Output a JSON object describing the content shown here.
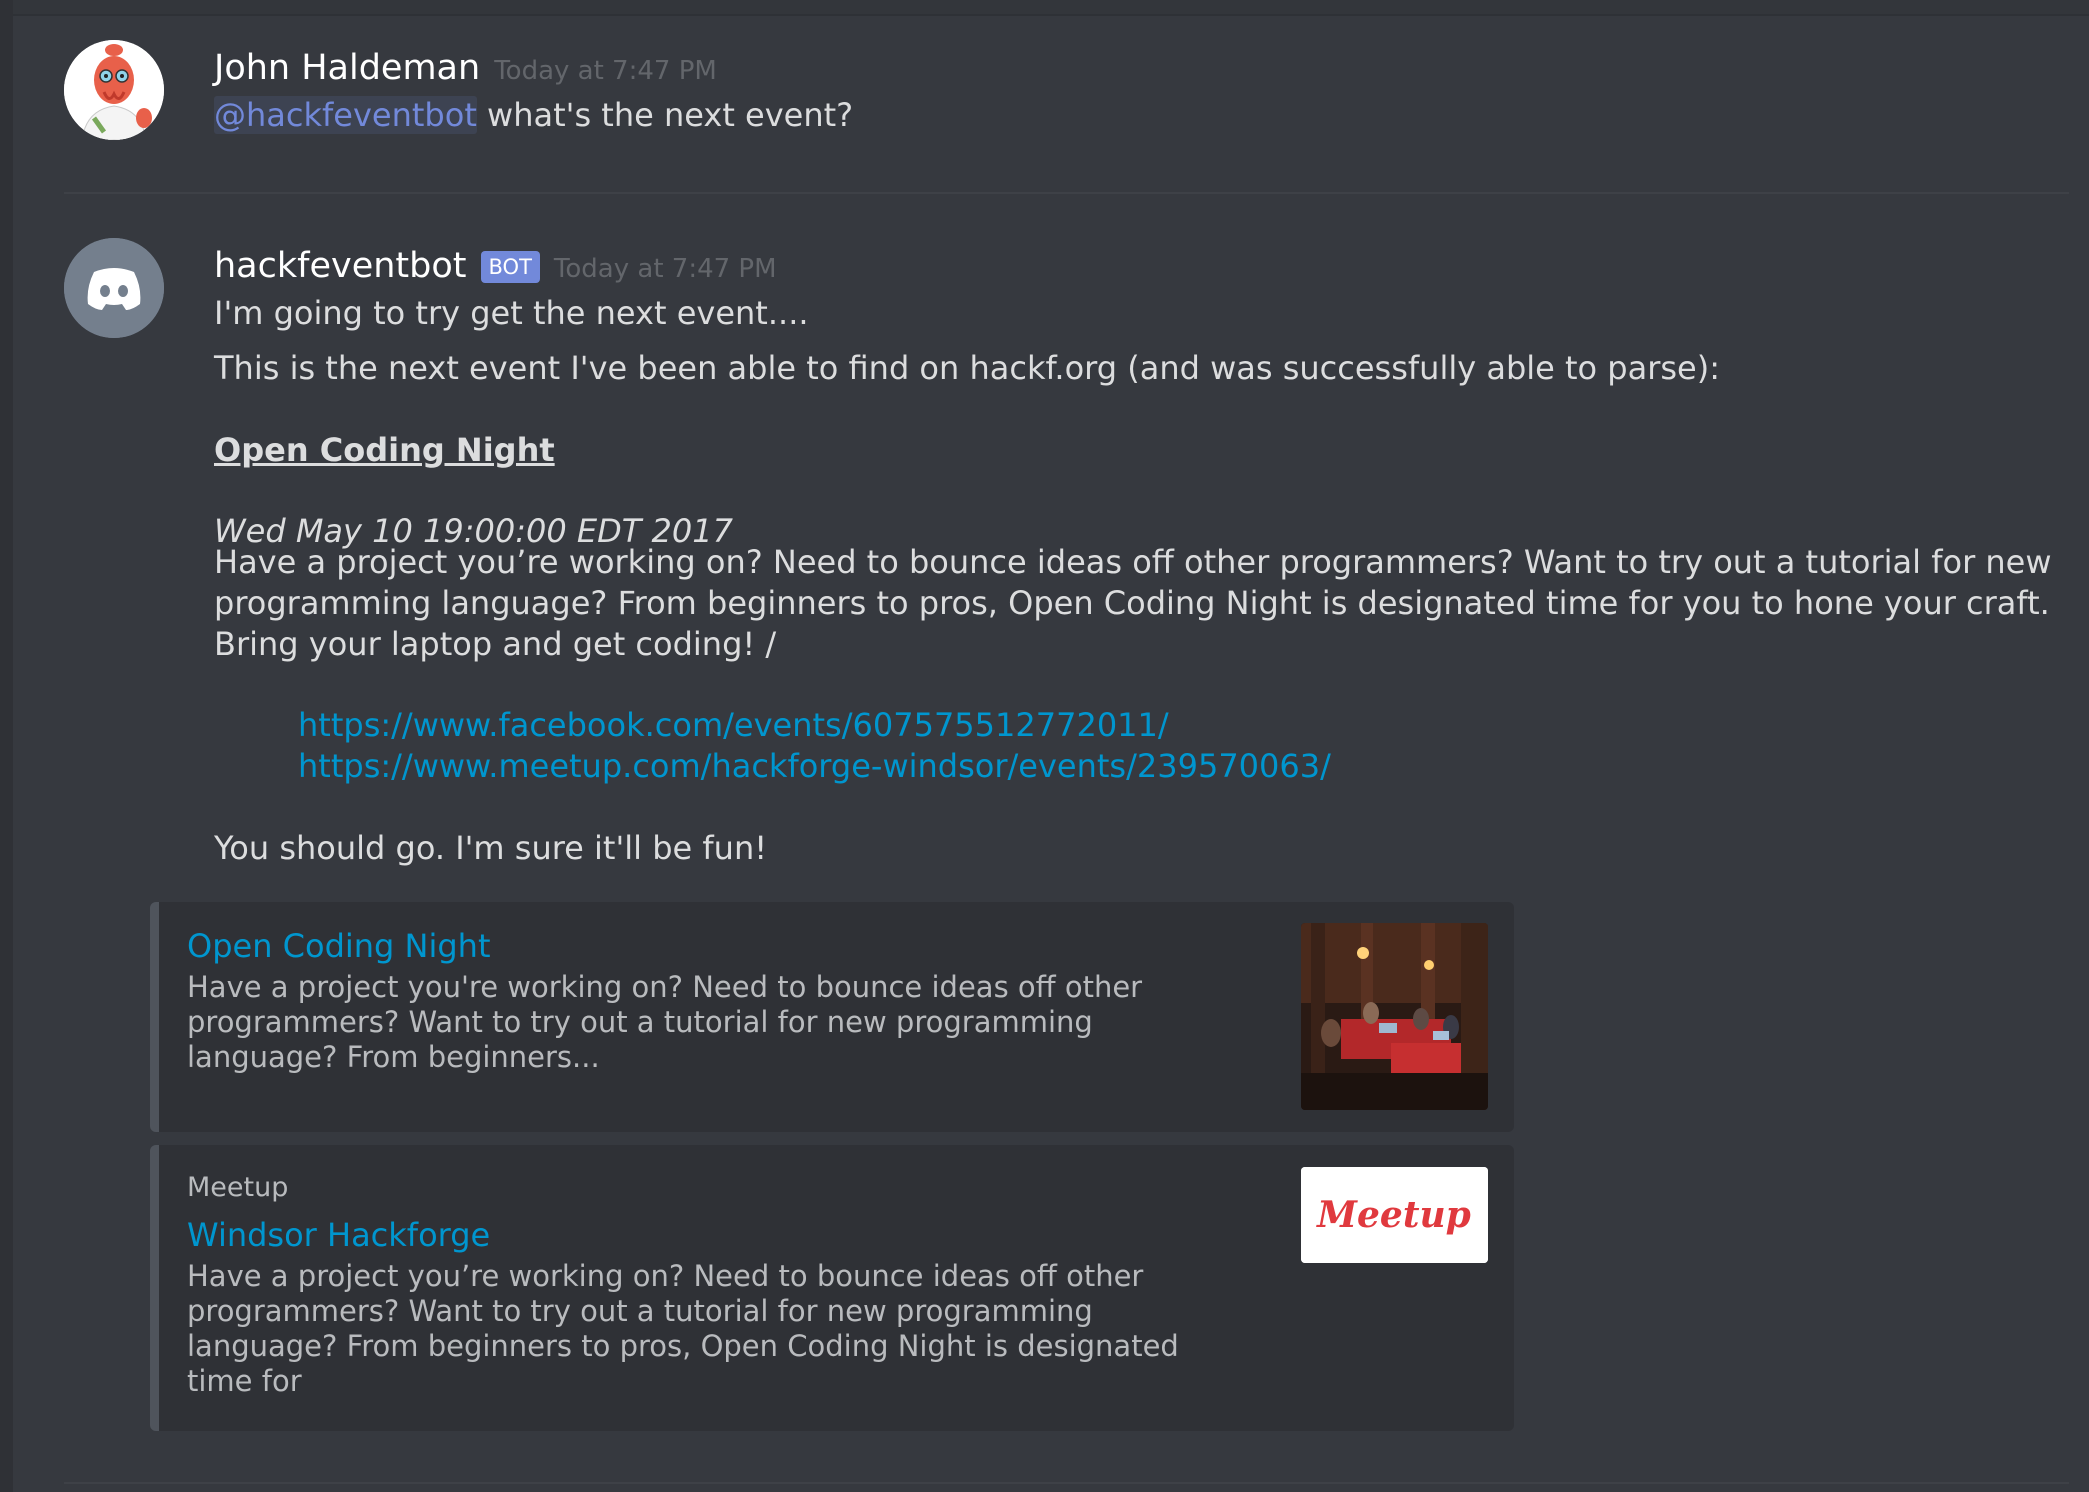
{
  "messages": [
    {
      "author": "John Haldeman",
      "timestamp": "Today at 7:47 PM",
      "mention": "@hackfeventbot",
      "text": " what's the next event?"
    },
    {
      "author": "hackfeventbot",
      "bot_tag": "BOT",
      "timestamp": "Today at 7:47 PM",
      "line1": "I'm going to try get the next event....",
      "line2": "This is the next event I've been able to find on hackf.org (and was successfully able to parse):",
      "event_title": "Open Coding Night",
      "event_date": "Wed May 10 19:00:00 EDT 2017",
      "event_desc_lines": [
        "Have a project you’re working on? Need to bounce ideas off other programmers? Want to try out a tutorial for new",
        "programming language? From beginners to pros, Open Coding Night is designated time for you to hone your craft.",
        "Bring your laptop and get coding! /"
      ],
      "links": [
        "https://www.facebook.com/events/607575512772011/",
        "https://www.meetup.com/hackforge-windsor/events/239570063/"
      ],
      "closing": "You should go. I'm sure it'll be fun!"
    }
  ],
  "embeds": [
    {
      "title": "Open Coding Night",
      "desc_lines": [
        "Have a project you're working on? Need to bounce ideas off other",
        "programmers? Want to try out a tutorial for new programming",
        "language? From beginners..."
      ],
      "thumbnail": "photo-of-people-coding-in-booths"
    },
    {
      "provider": "Meetup",
      "title": "Windsor Hackforge",
      "desc_lines": [
        "Have a project you’re working on? Need to bounce ideas off other",
        "programmers? Want to try out a tutorial for new programming",
        "language? From beginners to pros, Open Coding Night is designated",
        "time for"
      ],
      "thumbnail_logo_text": "Meetup"
    }
  ],
  "colors": {
    "background": "#36393f",
    "mention": "#7289da",
    "link": "#0096cf",
    "bot_tag": "#7289da"
  }
}
